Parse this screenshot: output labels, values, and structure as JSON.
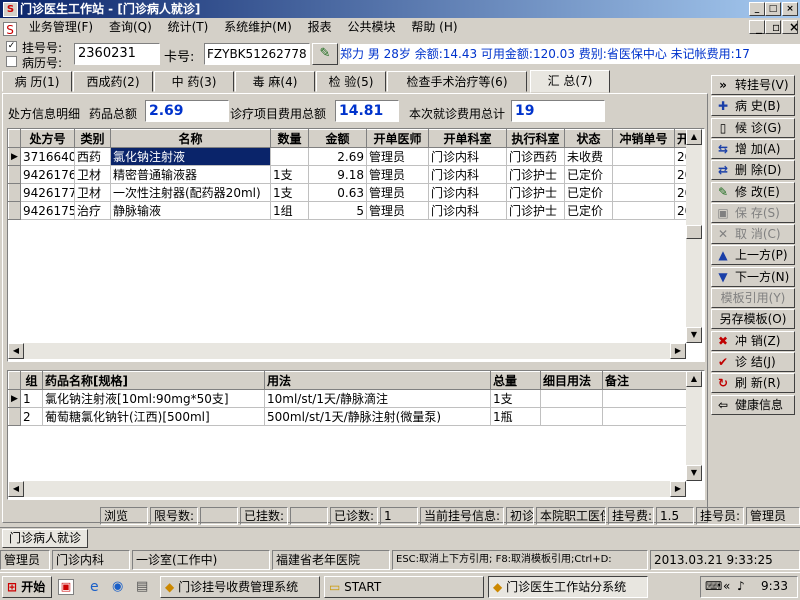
{
  "window": {
    "outer_title": "门诊医生工作站 - [门诊病人就诊]"
  },
  "menu": [
    "业务管理(F)",
    "查询(Q)",
    "统计(T)",
    "系统维护(M)",
    "报表",
    "公共模块",
    "帮助 (H)"
  ],
  "patient": {
    "reg_label": "挂号号:",
    "reg_value": "2360231",
    "record_label": "病历号:",
    "card_label": "卡号:",
    "card_value": "FZYBK51262778",
    "info": "郑力 男 28岁 余额:14.43 可用金额:120.03 费别:省医保中心 未记帐费用:17"
  },
  "tabs": [
    "病 历(1)",
    "西成药(2)",
    "中 药(3)",
    "毒 麻(4)",
    "检 验(5)",
    "检查手术治疗等(6)",
    "汇 总(7)"
  ],
  "summary": {
    "title": "处方信息明细",
    "drug_label": "药品总额",
    "drug_value": "2.69",
    "proj_label": "诊疗项目费用总额",
    "proj_value": "14.81",
    "total_label": "本次就诊费用总计",
    "total_value": "19"
  },
  "upper_table": {
    "headers": [
      "处方号",
      "类别",
      "名称",
      "数量",
      "金额",
      "开单医师",
      "开单科室",
      "执行科室",
      "状态",
      "冲销单号",
      "开"
    ],
    "rows": [
      [
        "3716640",
        "西药",
        "氯化钠注射液",
        "",
        "2.69",
        "管理员",
        "门诊内科",
        "门诊西药",
        "未收费",
        "",
        "20"
      ],
      [
        "9426176",
        "卫材",
        "精密普通输液器",
        "1支",
        "9.18",
        "管理员",
        "门诊内科",
        "门诊护士",
        "已定价",
        "",
        "20"
      ],
      [
        "9426177",
        "卫材",
        "一次性注射器(配药器20ml)",
        "1支",
        "0.63",
        "管理员",
        "门诊内科",
        "门诊护士",
        "已定价",
        "",
        "20"
      ],
      [
        "9426175",
        "治疗",
        "静脉输液",
        "1组",
        "5",
        "管理员",
        "门诊内科",
        "门诊护士",
        "已定价",
        "",
        "20"
      ]
    ]
  },
  "lower_table": {
    "headers": [
      "组",
      "药品名称[规格]",
      "用法",
      "总量",
      "细目用法",
      "备注"
    ],
    "rows": [
      [
        "1",
        "氯化钠注射液[10ml:90mg*50支]",
        "10ml/st/1天/静脉滴注",
        "1支",
        "",
        ""
      ],
      [
        "2",
        "葡萄糖氯化钠针(江西)[500ml]",
        "500ml/st/1天/静脉注射(微量泵)",
        "1瓶",
        "",
        ""
      ]
    ]
  },
  "side_buttons": [
    {
      "icon": "»",
      "label": "转挂号(V)",
      "name": "transfer-button",
      "disabled": false,
      "color": "#000"
    },
    {
      "icon": "✚",
      "label": "病 史(B)",
      "name": "history-button",
      "disabled": false,
      "color": "#1a3fa8"
    },
    {
      "icon": "▯",
      "label": "候 诊(G)",
      "name": "waiting-button",
      "disabled": false,
      "color": "#000"
    },
    {
      "icon": "⇆",
      "label": "增 加(A)",
      "name": "add-button",
      "disabled": false,
      "color": "#1a3fa8"
    },
    {
      "icon": "⇄",
      "label": "删 除(D)",
      "name": "delete-button",
      "disabled": false,
      "color": "#1a3fa8"
    },
    {
      "icon": "✎",
      "label": "修 改(E)",
      "name": "edit-button",
      "disabled": false,
      "color": "#1a6a1a"
    },
    {
      "icon": "▣",
      "label": "保 存(S)",
      "name": "save-button",
      "disabled": true,
      "color": "#808080"
    },
    {
      "icon": "✕",
      "label": "取 消(C)",
      "name": "cancel-button",
      "disabled": true,
      "color": "#808080"
    },
    {
      "icon": "▲",
      "label": "上一方(P)",
      "name": "prev-button",
      "disabled": false,
      "color": "#1a3fa8"
    },
    {
      "icon": "▼",
      "label": "下一方(N)",
      "name": "next-button",
      "disabled": false,
      "color": "#1a3fa8"
    },
    {
      "icon": "",
      "label": "模板引用(Y)",
      "name": "template-ref-button",
      "disabled": true,
      "color": "#808080"
    },
    {
      "icon": "",
      "label": "另存模板(O)",
      "name": "save-template-button",
      "disabled": false,
      "color": "#000"
    },
    {
      "icon": "✖",
      "label": "冲 销(Z)",
      "name": "writeoff-button",
      "disabled": false,
      "color": "#c00000"
    },
    {
      "icon": "✔",
      "label": "诊 结(J)",
      "name": "finish-button",
      "disabled": false,
      "color": "#c00000"
    },
    {
      "icon": "↻",
      "label": "刷 新(R)",
      "name": "refresh-button",
      "disabled": false,
      "color": "#c00000"
    },
    {
      "icon": "⇦",
      "label": "健康信息",
      "name": "health-info-button",
      "disabled": false,
      "color": "#000"
    }
  ],
  "status": {
    "browse": "浏览",
    "reg_count_label": "限号数:",
    "registered_label": "已挂数:",
    "visited_label": "已诊数:",
    "visited_value": "1",
    "cur_info_label": "当前挂号信息:",
    "cur_type": "初诊",
    "cur_dept": "本院职工医保",
    "fee_label": "挂号费:",
    "fee_value": "1.5",
    "clerk_label": "挂号员:",
    "clerk_value": "管理员"
  },
  "doc_tab": "门诊病人就诊",
  "status2": {
    "user": "管理员",
    "dept": "门诊内科",
    "room": "一诊室(工作中)",
    "hospital": "福建省老年医院",
    "hint": "ESC:取消上下方引用; F8:取消模板引用;Ctrl+D:",
    "datetime": "2013.03.21 9:33:25"
  },
  "taskbar": {
    "start": "开始",
    "items": [
      "门诊挂号收费管理系统",
      "START",
      "门诊医生工作站分系统"
    ],
    "clock": "9:33"
  }
}
